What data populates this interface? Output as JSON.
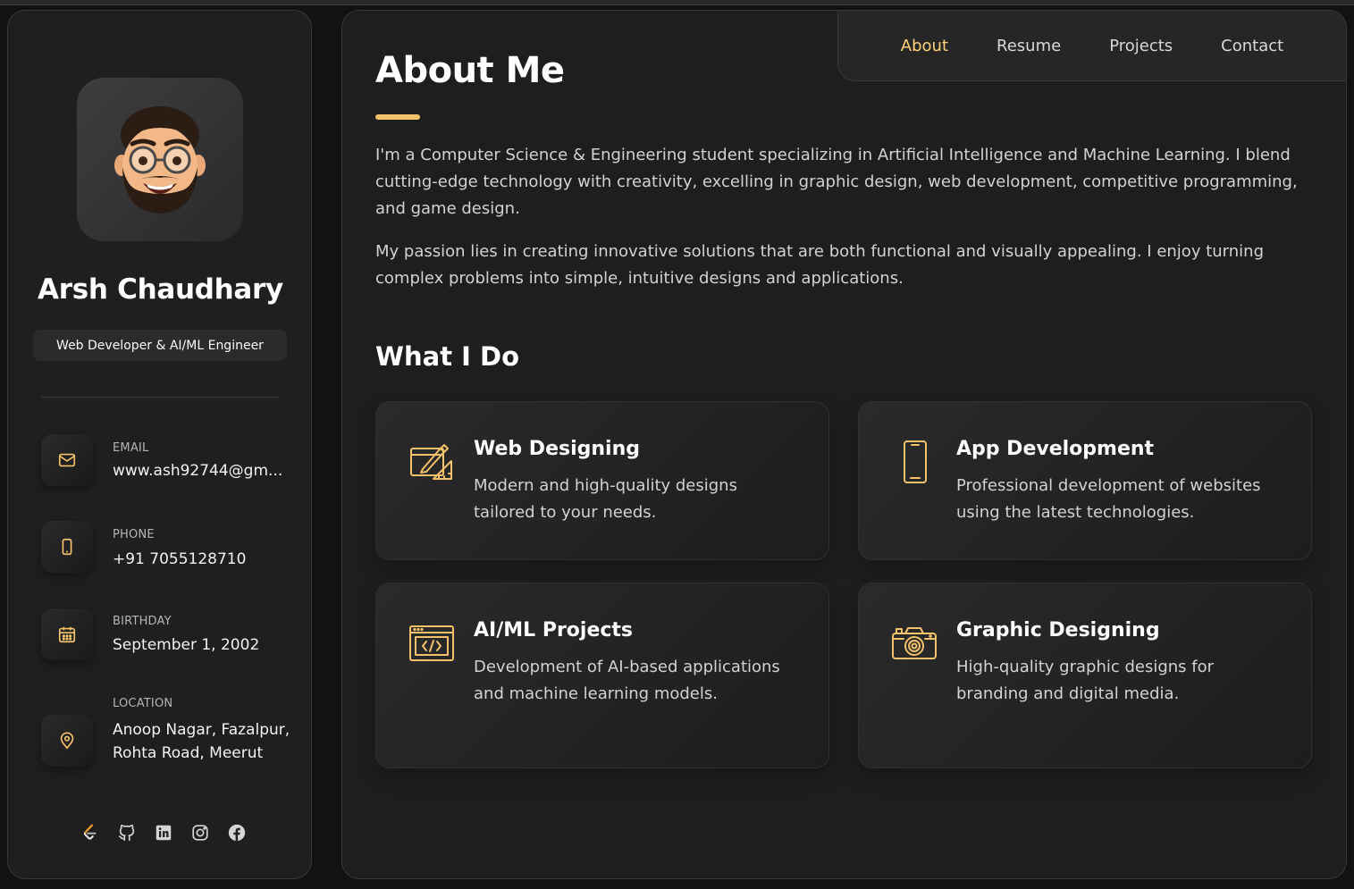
{
  "colors": {
    "accent": "#f3c26b",
    "background": "#121212",
    "card": "#1e1e1f"
  },
  "profile": {
    "avatar_icon": "memoji-avatar",
    "name": "Arsh Chaudhary",
    "title": "Web Developer & AI/ML Engineer"
  },
  "contacts": [
    {
      "icon": "mail-icon",
      "label": "EMAIL",
      "value": "www.ash92744@gm..."
    },
    {
      "icon": "phone-icon",
      "label": "PHONE",
      "value": "+91 7055128710"
    },
    {
      "icon": "calendar-icon",
      "label": "BIRTHDAY",
      "value": "September 1, 2002"
    },
    {
      "icon": "location-pin-icon",
      "label": "LOCATION",
      "value": "Anoop Nagar, Fazalpur, Rohta Road, Meerut"
    }
  ],
  "socials": [
    "leetcode-icon",
    "github-icon",
    "linkedin-icon",
    "instagram-icon",
    "facebook-icon"
  ],
  "nav": {
    "items": [
      "About",
      "Resume",
      "Projects",
      "Contact"
    ],
    "active": "About"
  },
  "about": {
    "title": "About Me",
    "paragraphs": [
      "I'm a Computer Science & Engineering student specializing in Artificial Intelligence and Machine Learning. I blend cutting-edge technology with creativity, excelling in graphic design, web development, competitive programming, and game design.",
      "My passion lies in creating innovative solutions that are both functional and visually appealing. I enjoy turning complex problems into simple, intuitive designs and applications."
    ]
  },
  "services": {
    "title": "What I Do",
    "items": [
      {
        "icon": "design-tools-icon",
        "title": "Web Designing",
        "text": "Modern and high-quality designs tailored to your needs."
      },
      {
        "icon": "smartphone-icon",
        "title": "App Development",
        "text": "Professional development of websites using the latest technologies."
      },
      {
        "icon": "code-window-icon",
        "title": "AI/ML Projects",
        "text": "Development of AI-based applications and machine learning models."
      },
      {
        "icon": "camera-icon",
        "title": "Graphic Designing",
        "text": "High-quality graphic designs for branding and digital media."
      }
    ]
  }
}
